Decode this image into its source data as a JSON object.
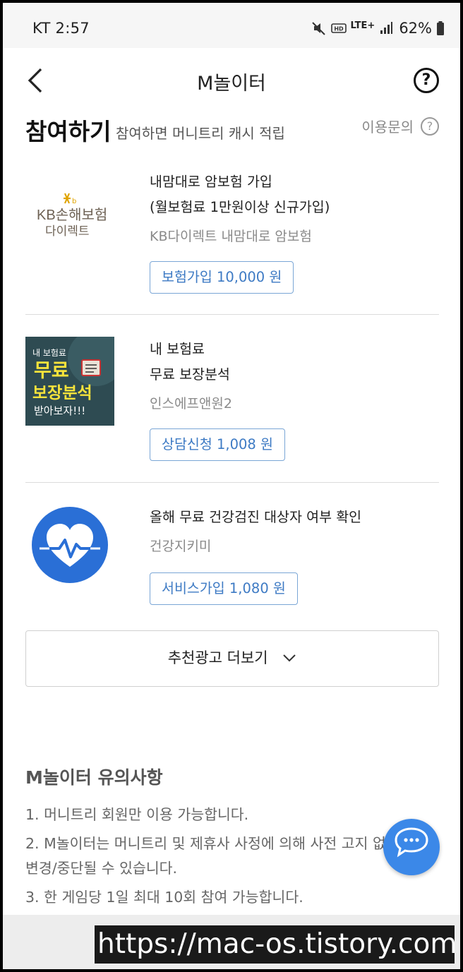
{
  "status_bar": {
    "carrier_time": "KT 2:57",
    "network": "LTE+",
    "battery": "62%"
  },
  "header": {
    "title": "M놀이터",
    "help_icon": "question-circle-icon",
    "back_icon": "chevron-left-icon"
  },
  "section": {
    "title": "참여하기",
    "subtitle": "참여하면 머니트리 캐시 적립",
    "inquiry_label": "이용문의"
  },
  "items": [
    {
      "logo_text_1": "KB손해보험",
      "logo_text_2": "다이렉트",
      "title_1": "내맘대로 암보험 가입",
      "title_2": "(월보험료 1만원이상 신규가입)",
      "provider": "KB다이렉트 내맘대로 암보험",
      "reward": "보험가입 10,000 원"
    },
    {
      "banner_line_1": "내 보험료",
      "banner_line_2": "무료",
      "banner_line_3": "보장분석",
      "banner_line_4": "받아보자!!!",
      "title_1": "내 보험료",
      "title_2": "무료 보장분석",
      "provider": "인스에프앤원2",
      "reward": "상담신청 1,008 원"
    },
    {
      "icon": "heart-pulse-icon",
      "title_1": "올해 무료 건강검진 대상자 여부 확인",
      "provider": "건강지키미",
      "reward": "서비스가입 1,080 원"
    }
  ],
  "more_button": {
    "label": "추천광고 더보기"
  },
  "notice": {
    "title": "M놀이터 유의사항",
    "lines": [
      "1. 머니트리 회원만 이용 가능합니다.",
      "2. M놀이터는 머니트리 및 제휴사 사정에 의해 사전 고지 없이",
      "변경/중단될 수 있습니다.",
      "3. 한 게임당 1일 최대 10회 참여 가능합니다."
    ]
  },
  "watermark": "https://mac-os.tistory.com",
  "colors": {
    "accent_blue": "#3b88e8",
    "reward_text": "#3d7ac4",
    "kb_gold": "#e0a400"
  }
}
